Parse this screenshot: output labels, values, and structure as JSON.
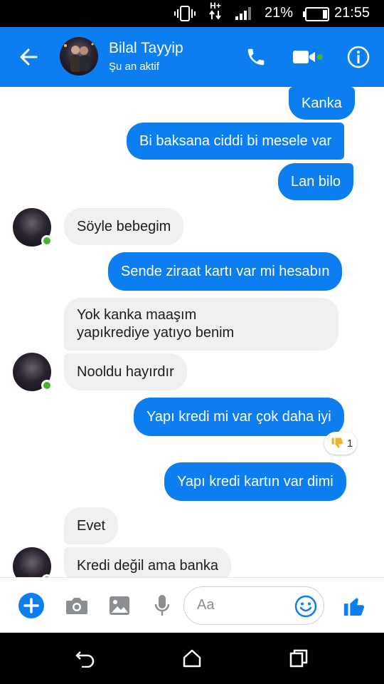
{
  "status_bar": {
    "network": "H+",
    "battery_percent": "21%",
    "time": "21:55",
    "icons": [
      "vibrate-icon",
      "signal-icon",
      "battery-icon"
    ]
  },
  "header": {
    "contact_name": "Bilal Tayyip",
    "contact_status": "Şu an aktif",
    "icons": [
      "back-arrow-icon",
      "phone-icon",
      "video-camera-icon",
      "info-icon"
    ],
    "accent_color": "#0d7ef0",
    "online_color": "#42b72a"
  },
  "messages": [
    {
      "direction": "out",
      "text": "Kanka"
    },
    {
      "direction": "out",
      "text": "Bi baksana ciddi bi mesele var"
    },
    {
      "direction": "out",
      "text": "Lan bilo"
    },
    {
      "direction": "in",
      "text": "Söyle bebegim"
    },
    {
      "direction": "out",
      "text": "Sende ziraat kartı var mi hesabın"
    },
    {
      "direction": "in",
      "lines": [
        "Yok kanka maaşım",
        "yapıkrediye yatıyo benim"
      ]
    },
    {
      "direction": "in",
      "text": "Nooldu hayırdır"
    },
    {
      "direction": "out",
      "text": "Yapı kredi mi var çok daha iyi",
      "reaction": {
        "icon": "thumbs-down-icon",
        "count": "1"
      }
    },
    {
      "direction": "out",
      "text": "Yapı kredi kartın var dimi"
    },
    {
      "direction": "in",
      "text": "Evet"
    },
    {
      "direction": "in",
      "text": "Kredi değil ama banka"
    }
  ],
  "composer": {
    "placeholder": "Aa",
    "icons": [
      "add-icon",
      "camera-icon",
      "image-icon",
      "microphone-icon",
      "emoji-icon",
      "thumbs-up-icon"
    ]
  },
  "nav_bar": {
    "icons": [
      "back-icon",
      "home-icon",
      "recent-apps-icon"
    ]
  }
}
